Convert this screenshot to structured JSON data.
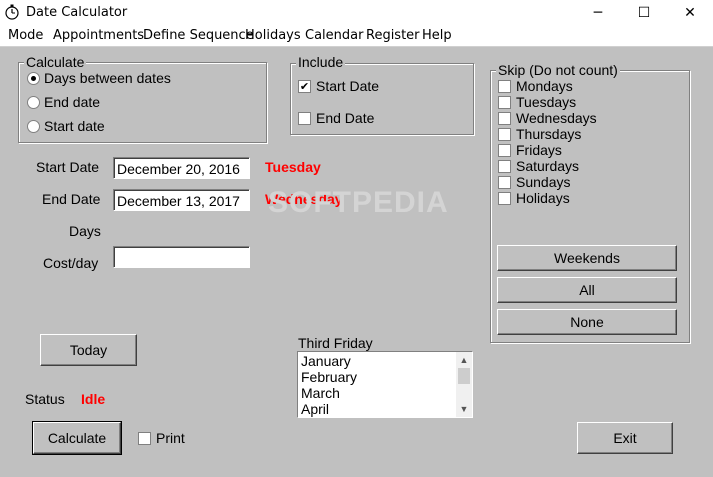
{
  "window": {
    "title": "Date Calculator",
    "minimize": "─",
    "maximize": "☐",
    "close": "✕"
  },
  "menu": [
    "Mode",
    "Appointments",
    "Define Sequence",
    "Holidays",
    "Calendar",
    "Register",
    "Help"
  ],
  "calculate": {
    "label": "Calculate",
    "options": [
      {
        "label": "Days between dates",
        "checked": true
      },
      {
        "label": "End date",
        "checked": false
      },
      {
        "label": "Start date",
        "checked": false
      }
    ]
  },
  "include": {
    "label": "Include",
    "options": [
      {
        "label": "Start Date",
        "checked": true
      },
      {
        "label": "End Date",
        "checked": false
      }
    ]
  },
  "skip": {
    "label": "Skip (Do not count)",
    "options": [
      "Mondays",
      "Tuesdays",
      "Wednesdays",
      "Thursdays",
      "Fridays",
      "Saturdays",
      "Sundays",
      "Holidays"
    ],
    "weekends_button": "Weekends",
    "all_button": "All",
    "none_button": "None"
  },
  "form": {
    "start_label": "Start Date",
    "start_value": "December 20, 2016",
    "start_weekday": "Tuesday",
    "end_label": "End Date",
    "end_value": "December 13, 2017",
    "end_weekday": "Wednesday",
    "days_label": "Days",
    "cost_label": "Cost/day",
    "cost_value": ""
  },
  "buttons": {
    "today": "Today",
    "calculate": "Calculate",
    "exit": "Exit",
    "print": "Print"
  },
  "status": {
    "label": "Status",
    "value": "Idle"
  },
  "third_friday": {
    "label": "Third Friday",
    "months": [
      "January",
      "February",
      "March",
      "April"
    ]
  },
  "watermark": "SOFTPEDIA",
  "colors": {
    "accent_red": "#ff0000",
    "panel": "#c0c0c0"
  }
}
